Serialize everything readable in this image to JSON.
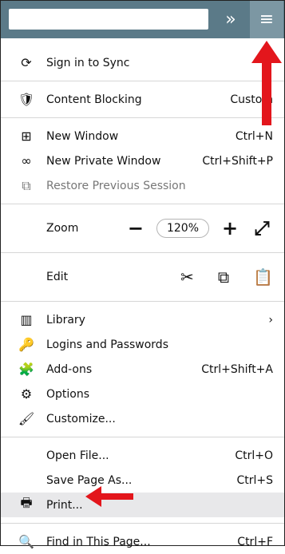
{
  "toolbar": {
    "overflow_label": "»",
    "menu_label": "≡"
  },
  "menu": {
    "sign_in": "Sign in to Sync",
    "content_blocking": {
      "label": "Content Blocking",
      "value": "Custom"
    },
    "new_window": {
      "label": "New Window",
      "shortcut": "Ctrl+N"
    },
    "new_private_window": {
      "label": "New Private Window",
      "shortcut": "Ctrl+Shift+P"
    },
    "restore_session": {
      "label": "Restore Previous Session"
    },
    "zoom": {
      "label": "Zoom",
      "minus": "−",
      "value": "120%",
      "plus": "+",
      "fullscreen": "⤢"
    },
    "edit": {
      "label": "Edit",
      "cut": "✂",
      "copy": "⧉",
      "paste": "📋"
    },
    "library": {
      "label": "Library",
      "chevron": "›"
    },
    "logins": {
      "label": "Logins and Passwords"
    },
    "addons": {
      "label": "Add-ons",
      "shortcut": "Ctrl+Shift+A"
    },
    "options": {
      "label": "Options"
    },
    "customize": {
      "label": "Customize..."
    },
    "open_file": {
      "label": "Open File...",
      "shortcut": "Ctrl+O"
    },
    "save_page": {
      "label": "Save Page As...",
      "shortcut": "Ctrl+S"
    },
    "print": {
      "label": "Print..."
    },
    "find": {
      "label": "Find in This Page...",
      "shortcut": "Ctrl+F"
    }
  },
  "colors": {
    "toolbar_bg": "#5b7a88",
    "annotation_arrow": "#e3161c"
  }
}
